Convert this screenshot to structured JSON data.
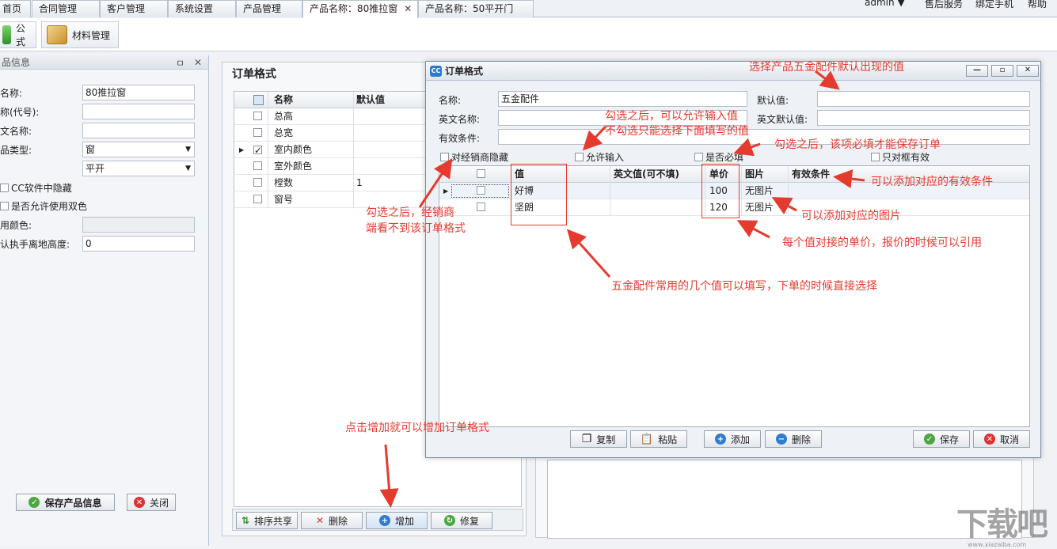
{
  "tabs": [
    "首页",
    "合同管理",
    "客户管理",
    "系统设置",
    "产品管理",
    "产品名称：80推拉窗",
    "产品名称：50平开门"
  ],
  "tab_close": "✕",
  "top_right": {
    "user": "admin",
    "service": "售后服务",
    "bind_phone": "绑定手机",
    "help": "帮助"
  },
  "ribbon": {
    "formula": "公式",
    "material": "材料管理"
  },
  "left": {
    "header": "品信息",
    "pin": "ㅁ",
    "close": "✕",
    "fields": [
      {
        "label": "名称:",
        "value": "80推拉窗"
      },
      {
        "label": "称(代号):",
        "value": ""
      },
      {
        "label": "文名称:",
        "value": ""
      },
      {
        "label": "品类型:",
        "value": "窗"
      },
      {
        "label": "",
        "value": "平开"
      }
    ],
    "hide_in_cc": "CC软件中隐藏",
    "allow_double": "是否允许使用双色",
    "color_label": "用颜色:",
    "handle_height_label": "认执手离地高度:",
    "handle_height_value": "0",
    "save_btn": "保存产品信息",
    "close_btn": "关闭"
  },
  "middle": {
    "title": "订单格式",
    "columns": [
      "名称",
      "默认值"
    ],
    "rows": [
      {
        "name": "总高",
        "value": "",
        "checked": false
      },
      {
        "name": "总宽",
        "value": "",
        "checked": false
      },
      {
        "name": "室内颜色",
        "value": "",
        "checked": true
      },
      {
        "name": "室外颜色",
        "value": "",
        "checked": false
      },
      {
        "name": "樘数",
        "value": "1",
        "checked": false
      },
      {
        "name": "窗号",
        "value": "",
        "checked": false
      }
    ],
    "buttons": {
      "sort": "排序共享",
      "delete": "删除",
      "add": "增加",
      "edit": "修复"
    }
  },
  "dialog": {
    "title": "订单格式",
    "logo": "CC",
    "win_buttons": [
      "—",
      "▫",
      "✕"
    ],
    "name_label": "名称:",
    "name_value": "五金配件",
    "default_label": "默认值:",
    "en_name_label": "英文名称:",
    "en_default_label": "英文默认值:",
    "valid_label": "有效条件:",
    "checks": {
      "dealer_hide": "对经销商隐藏",
      "allow_input": "允许输入",
      "required": "是否必填",
      "only_frame": "只对框有效"
    },
    "columns": [
      "值",
      "英文值(可不填)",
      "单价",
      "图片",
      "有效条件"
    ],
    "rows": [
      {
        "value": "好博",
        "en": "",
        "price": "100",
        "image": "无图片",
        "cond": ""
      },
      {
        "value": "坚朗",
        "en": "",
        "price": "120",
        "image": "无图片",
        "cond": ""
      }
    ],
    "buttons": {
      "copy": "复制",
      "paste": "粘贴",
      "add": "添加",
      "delete": "删除",
      "save": "保存",
      "cancel": "取消"
    }
  },
  "annotations": {
    "default_value": "选择产品五金配件默认出现的值",
    "allow_input_1": "勾选之后，可以允许输入值",
    "allow_input_2": "不勾选只能选择下面填写的值",
    "required": "勾选之后，该项必填才能保存订单",
    "condition": "可以添加对应的有效条件",
    "dealer_1": "勾选之后，经销商",
    "dealer_2": "端看不到该订单格式",
    "image": "可以添加对应的图片",
    "price": "每个值对接的单价，报价的时候可以引用",
    "values": "五金配件常用的几个值可以填写，下单的时候直接选择",
    "add": "点击增加就可以增加订单格式"
  },
  "watermark": {
    "main": "下载吧",
    "url": "www.xiazaiba.com"
  }
}
